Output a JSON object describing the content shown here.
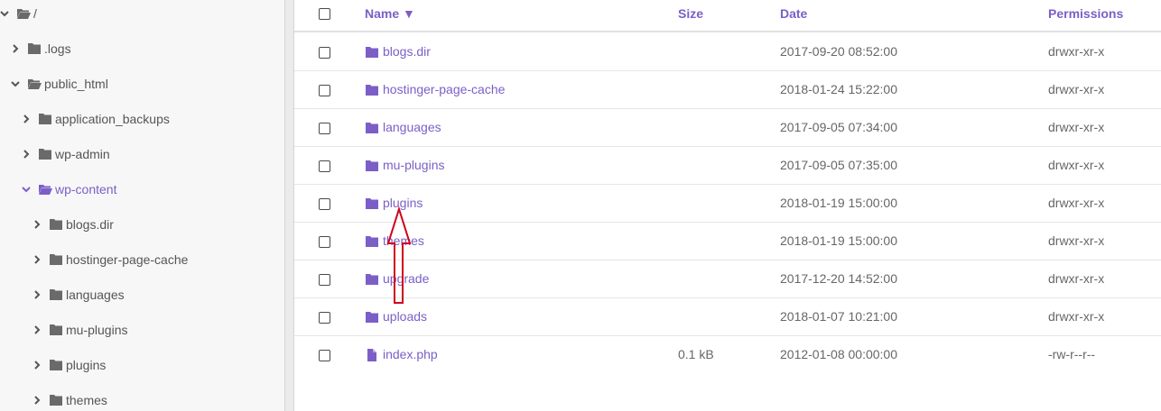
{
  "tree": {
    "items": [
      {
        "label": "/",
        "expanded": true,
        "active": false
      },
      {
        "label": ".logs",
        "expanded": false,
        "active": false
      },
      {
        "label": "public_html",
        "expanded": true,
        "active": false
      },
      {
        "label": "application_backups",
        "expanded": false,
        "active": false
      },
      {
        "label": "wp-admin",
        "expanded": false,
        "active": false
      },
      {
        "label": "wp-content",
        "expanded": true,
        "active": true
      },
      {
        "label": "blogs.dir",
        "expanded": false,
        "active": false
      },
      {
        "label": "hostinger-page-cache",
        "expanded": false,
        "active": false
      },
      {
        "label": "languages",
        "expanded": false,
        "active": false
      },
      {
        "label": "mu-plugins",
        "expanded": false,
        "active": false
      },
      {
        "label": "plugins",
        "expanded": false,
        "active": false
      },
      {
        "label": "themes",
        "expanded": false,
        "active": false
      }
    ]
  },
  "table": {
    "headers": {
      "name": "Name ▼",
      "size": "Size",
      "date": "Date",
      "permissions": "Permissions"
    },
    "rows": [
      {
        "name": "blogs.dir",
        "type": "folder",
        "size": "",
        "date": "2017-09-20 08:52:00",
        "permissions": "drwxr-xr-x"
      },
      {
        "name": "hostinger-page-cache",
        "type": "folder",
        "size": "",
        "date": "2018-01-24 15:22:00",
        "permissions": "drwxr-xr-x"
      },
      {
        "name": "languages",
        "type": "folder",
        "size": "",
        "date": "2017-09-05 07:34:00",
        "permissions": "drwxr-xr-x"
      },
      {
        "name": "mu-plugins",
        "type": "folder",
        "size": "",
        "date": "2017-09-05 07:35:00",
        "permissions": "drwxr-xr-x"
      },
      {
        "name": "plugins",
        "type": "folder",
        "size": "",
        "date": "2018-01-19 15:00:00",
        "permissions": "drwxr-xr-x"
      },
      {
        "name": "themes",
        "type": "folder",
        "size": "",
        "date": "2018-01-19 15:00:00",
        "permissions": "drwxr-xr-x"
      },
      {
        "name": "upgrade",
        "type": "folder",
        "size": "",
        "date": "2017-12-20 14:52:00",
        "permissions": "drwxr-xr-x"
      },
      {
        "name": "uploads",
        "type": "folder",
        "size": "",
        "date": "2018-01-07 10:21:00",
        "permissions": "drwxr-xr-x"
      },
      {
        "name": "index.php",
        "type": "file",
        "size": "0.1 kB",
        "date": "2012-01-08 00:00:00",
        "permissions": "-rw-r--r--"
      }
    ]
  },
  "colors": {
    "accent": "#7b5fc7",
    "folder_gray": "#6a6a6a",
    "annotation_arrow": "#d0021b"
  },
  "icons": {
    "folder": "folder-icon",
    "folder_open": "folder-open-icon",
    "file": "file-icon",
    "chevron_right": "chevron-right-icon",
    "chevron_down": "chevron-down-icon"
  }
}
